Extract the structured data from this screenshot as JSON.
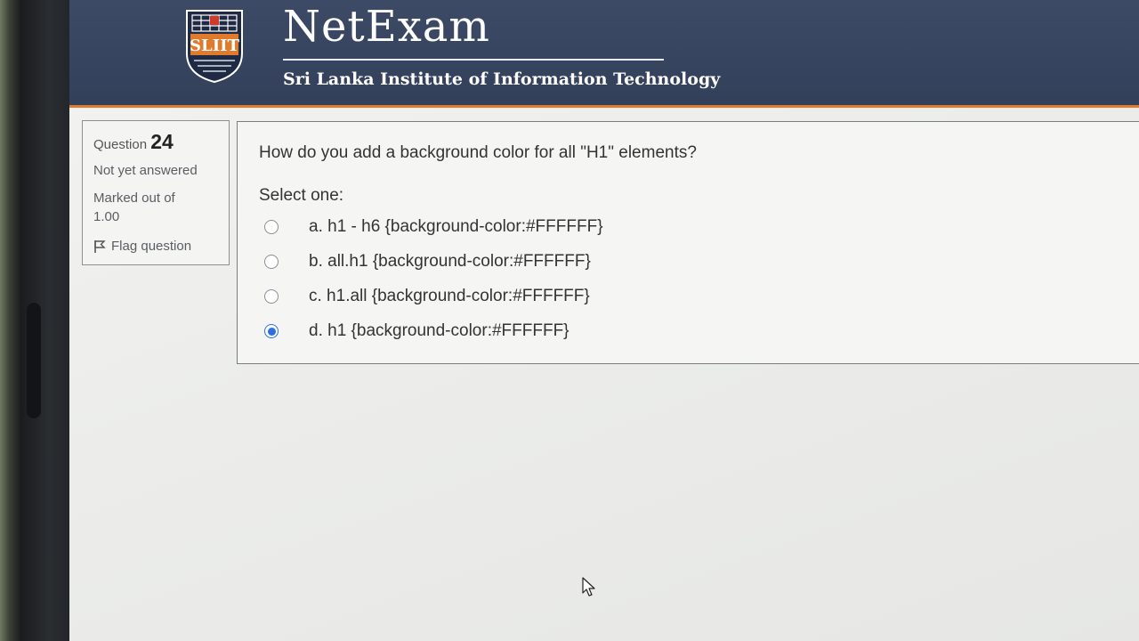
{
  "header": {
    "title": "NetExam",
    "subtitle": "Sri Lanka Institute of Information Technology",
    "logo_text": "SLIIT"
  },
  "info": {
    "question_label": "Question",
    "question_number": "24",
    "state": "Not yet answered",
    "marks_label": "Marked out of",
    "marks_value": "1.00",
    "flag_label": "Flag question",
    "flag_icon": "flag-icon"
  },
  "question": {
    "text": "How do you add a background color for all \"H1\" elements?",
    "prompt": "Select one:",
    "options": [
      {
        "label": "a. h1 - h6 {background-color:#FFFFFF}",
        "selected": false
      },
      {
        "label": "b. all.h1 {background-color:#FFFFFF}",
        "selected": false
      },
      {
        "label": "c. h1.all {background-color:#FFFFFF}",
        "selected": false
      },
      {
        "label": "d. h1 {background-color:#FFFFFF}",
        "selected": true
      }
    ]
  },
  "colors": {
    "header_bg": "#3d4a66",
    "accent_orange": "#e07a2c",
    "radio_selected": "#2b6fe0"
  }
}
